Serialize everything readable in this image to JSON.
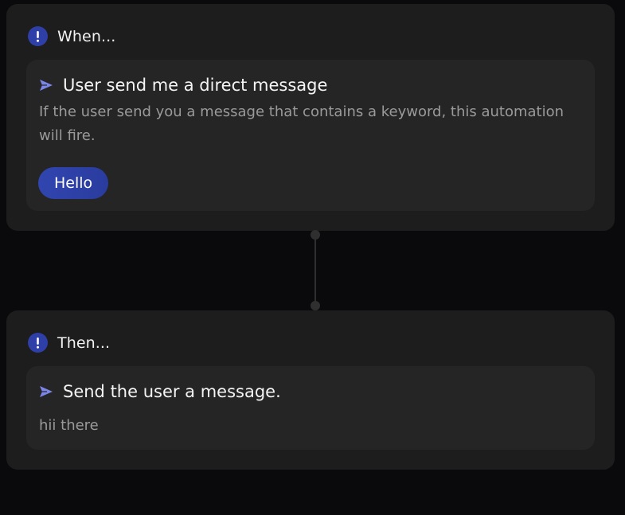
{
  "when": {
    "header": "When...",
    "trigger": {
      "title": "User send me a direct message",
      "description": "If the user send you a message that contains a keyword, this automation will fire.",
      "keywords": [
        "Hello"
      ]
    }
  },
  "then": {
    "header": "Then...",
    "action": {
      "title": "Send the user a message.",
      "message": "hii there"
    }
  },
  "colors": {
    "accent": "#2f3fa8",
    "send_icon": "#7b86e8",
    "card_bg": "#1d1d1d",
    "inner_bg": "#252525",
    "page_bg": "#0a0a0c"
  },
  "icons": {
    "header": "exclamation-circle-icon",
    "item": "send-arrow-icon"
  }
}
